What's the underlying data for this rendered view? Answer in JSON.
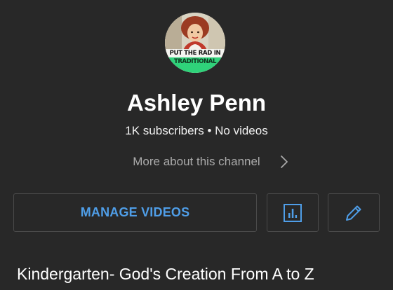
{
  "channel": {
    "avatar_text_line1": "PUT THE RAD IN",
    "avatar_text_line2": "TRADITIONAL",
    "name": "Ashley Penn",
    "stats": "1K subscribers • No videos",
    "more_about": "More about this channel"
  },
  "actions": {
    "manage_videos_label": "MANAGE VIDEOS",
    "analytics_icon": "analytics-bar-chart-icon",
    "edit_icon": "pencil-edit-icon"
  },
  "playlist": {
    "title": "Kindergarten- God's Creation From A to Z"
  },
  "colors": {
    "background": "#282828",
    "accent_blue": "#4f9ee8",
    "secondary_text": "#aaaaaa",
    "button_border": "#4a4a4a"
  }
}
